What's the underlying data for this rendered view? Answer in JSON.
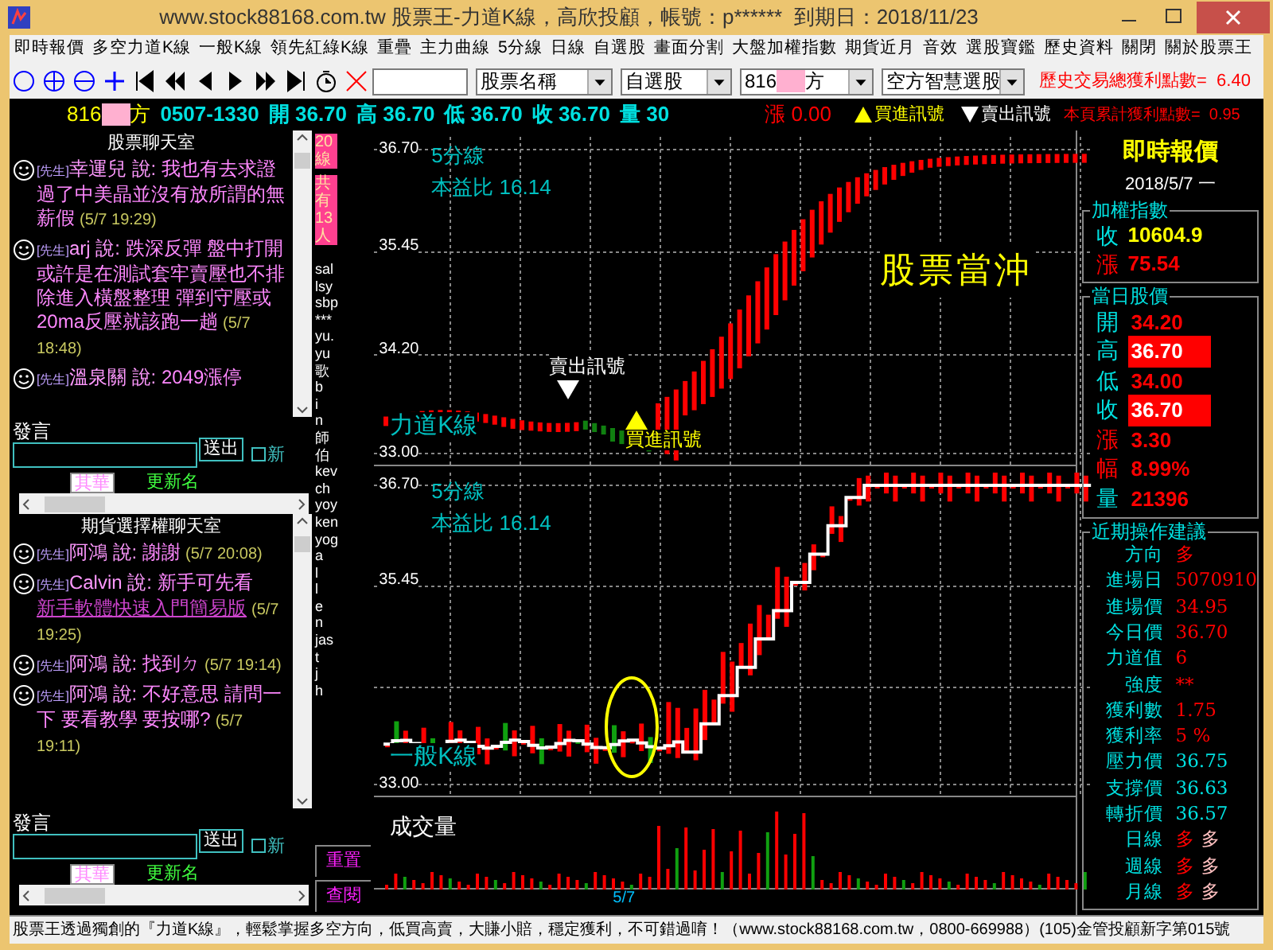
{
  "window": {
    "title": "www.stock88168.com.tw 股票王-力道K線，高欣投顧，帳號：p******  到期日：2018/11/23"
  },
  "menu": [
    "即時報價",
    "多空力道K線",
    "一般K線",
    "領先紅綠K線",
    "重疊",
    "主力曲線",
    "5分線",
    "日線",
    "自選股",
    "畫面分割",
    "大盤加權指數",
    "期貨近月",
    "音效",
    "選股寶鑑",
    "歷史資料",
    "關閉",
    "關於股票王"
  ],
  "toolbar": {
    "stock_name_select": "股票名稱",
    "watchlist_select": "自選股",
    "stock_select": {
      "prefix": "816",
      "suffix": "方"
    },
    "strategy_select": "空方智慧選股",
    "total_profit": "歷史交易總獲利點數=  6.40"
  },
  "info_bar": {
    "stock": {
      "prefix": "816",
      "suffix": "方"
    },
    "time": "0507-1330",
    "quotes": [
      "開 36.70",
      "高 36.70",
      "低 36.70",
      "收 36.70",
      "量 30"
    ],
    "change": "漲 0.00",
    "buy_signal": "買進訊號",
    "sell_signal": "賣出訊號",
    "page_profit": "本頁累計獲利點數=  0.95"
  },
  "chat_rooms": [
    {
      "title": "股票聊天室",
      "messages": [
        {
          "title": "[先生]",
          "user": "幸運兒",
          "says": "說:",
          "parts": [
            {
              "kind": "text",
              "text": "我也有去求證過了中美晶並沒有放所謂的無薪假"
            }
          ],
          "time": "(5/7 19:29)"
        },
        {
          "title": "[先生]",
          "user": "arj",
          "says": "說:",
          "parts": [
            {
              "kind": "text",
              "text": "跌深反彈 盤中打開或許是在測試套牢賣壓也不排除進入橫盤整理 彈到守壓或20ma反壓就該跑一趟"
            }
          ],
          "time": "(5/7 18:48)"
        },
        {
          "title": "[先生]",
          "user": "溫泉關",
          "says": "說:",
          "parts": [
            {
              "kind": "text",
              "text": "2049漲停"
            }
          ]
        }
      ],
      "speak_label": "發言",
      "send_button": "送出",
      "checkbox_label": "新",
      "checked": false,
      "name_select": "其華",
      "update_name": "更新名"
    },
    {
      "title": "期貨選擇權聊天室",
      "messages": [
        {
          "title": "[先生]",
          "user": "阿鴻",
          "says": "說:",
          "parts": [
            {
              "kind": "text",
              "text": "謝謝"
            }
          ],
          "time": "(5/7 20:08)"
        },
        {
          "title": "[先生]",
          "user": "Calvin",
          "says": "說:",
          "parts": [
            {
              "kind": "text",
              "text": "新手可先看"
            },
            {
              "kind": "link",
              "text": "新手軟體快速入門簡易版"
            }
          ],
          "time": "(5/7 19:25)"
        },
        {
          "title": "[先生]",
          "user": "阿鴻",
          "says": "說:",
          "parts": [
            {
              "kind": "text",
              "text": "找到ㄉ"
            }
          ],
          "time": "(5/7 19:14)"
        },
        {
          "title": "[先生]",
          "user": "阿鴻",
          "says": "說:",
          "parts": [
            {
              "kind": "text",
              "text": "不好意思 請問一下 要看教學 要按哪?"
            }
          ],
          "time": "(5/7 19:11)"
        }
      ],
      "speak_label": "發言",
      "send_button": "送出",
      "checkbox_label": "新",
      "checked": false,
      "name_select": "其華",
      "update_name": "更新名"
    }
  ],
  "side_column": {
    "banners": [
      "20線",
      "共有13人"
    ],
    "users": [
      "sal",
      "lsy",
      "sbp",
      "***",
      "yu.",
      "yu",
      "歌",
      "b",
      "i",
      "n",
      "師",
      "伯",
      "kev",
      "ch",
      "yoy",
      "ken",
      "yog",
      "a",
      "l",
      "l",
      "e",
      "n",
      "jas",
      "t",
      "j",
      "h"
    ],
    "buttons": [
      "重置",
      "查閱"
    ]
  },
  "charts": {
    "top": {
      "period": "5分線",
      "pe": "本益比 16.14",
      "yticks": [
        "36.70",
        "35.45",
        "34.20",
        "33.00"
      ],
      "banner": "股票當沖",
      "sell_label": "賣出訊號",
      "buy_label": "買進訊號",
      "name": "力道K線"
    },
    "bottom": {
      "period": "5分線",
      "pe": "本益比 16.14",
      "yticks": [
        "36.70",
        "35.45",
        "33.00"
      ],
      "name": "一般K線"
    },
    "volume": {
      "title": "成交量"
    },
    "x_label": "5/7"
  },
  "quote_panel": {
    "title": "即時報價",
    "date": "2018/5/7 一",
    "index": {
      "title": "加權指數",
      "items": [
        {
          "label": "收",
          "color": "#00e0e0",
          "value": {
            "text": "10604.9",
            "color": "#ffff00"
          }
        },
        {
          "label": "漲",
          "color": "#ff0000",
          "value": {
            "text": "75.54",
            "color": "#ff0000"
          }
        }
      ]
    },
    "daily": {
      "title": "當日股價",
      "items": [
        {
          "label": "開",
          "value": "34.20",
          "color": "#00e0e0",
          "highlight": false
        },
        {
          "label": "高",
          "value": "36.70",
          "color": "#00e0e0",
          "highlight": true
        },
        {
          "label": "低",
          "value": "34.00",
          "color": "#00e0e0",
          "highlight": false
        },
        {
          "label": "收",
          "value": "36.70",
          "color": "#00e0e0",
          "highlight": true
        },
        {
          "label": "漲",
          "value": "3.30",
          "color": "#ff0000",
          "highlight": false
        },
        {
          "label": "幅",
          "value": "8.99%",
          "color": "#ff0000",
          "highlight": false
        },
        {
          "label": "量",
          "value": "21396",
          "color": "#00e0e0",
          "highlight": false
        }
      ]
    },
    "advice": {
      "title": "近期操作建議",
      "items": [
        {
          "label": "方向",
          "values": [
            {
              "text": "多",
              "color": "#ff0000"
            }
          ]
        },
        {
          "label": "進場日",
          "values": [
            {
              "text": "5070910",
              "color": "#ff0000"
            }
          ]
        },
        {
          "label": "進場價",
          "values": [
            {
              "text": "34.95",
              "color": "#ff0000"
            }
          ]
        },
        {
          "label": "今日價",
          "values": [
            {
              "text": "36.70",
              "color": "#ff0000"
            }
          ]
        },
        {
          "label": "力道值",
          "values": [
            {
              "text": "6",
              "color": "#ff0000"
            }
          ]
        },
        {
          "label": "強度",
          "values": [
            {
              "text": "**",
              "color": "#ff0000"
            }
          ]
        },
        {
          "label": "獲利數",
          "values": [
            {
              "text": "1.75",
              "color": "#ff0000"
            }
          ]
        },
        {
          "label": "獲利率",
          "values": [
            {
              "text": "5 %",
              "color": "#ff0000"
            }
          ]
        },
        {
          "label": "壓力價",
          "values": [
            {
              "text": "36.75",
              "color": "#00e0e0"
            }
          ]
        },
        {
          "label": "支撐價",
          "values": [
            {
              "text": "36.63",
              "color": "#00e0e0"
            }
          ]
        },
        {
          "label": "轉折價",
          "values": [
            {
              "text": "36.57",
              "color": "#00e0e0"
            }
          ]
        },
        {
          "label": "日線",
          "values": [
            {
              "text": "多",
              "color": "#ff0000"
            },
            {
              "text": "多",
              "color": "#ffc0c0"
            }
          ]
        },
        {
          "label": "週線",
          "values": [
            {
              "text": "多",
              "color": "#ff0000"
            },
            {
              "text": "多",
              "color": "#ffc0c0"
            }
          ]
        },
        {
          "label": "月線",
          "values": [
            {
              "text": "多",
              "color": "#ff0000"
            },
            {
              "text": "多",
              "color": "#ffc0c0"
            }
          ]
        }
      ]
    }
  },
  "status_bar": "股票王透過獨創的『力道K線』，輕鬆掌握多空方向，低買高賣，大賺小賠，穩定獲利，不可錯過唷！（www.stock88168.com.tw，0800-669988）(105)金管投顧新字第015號"
}
